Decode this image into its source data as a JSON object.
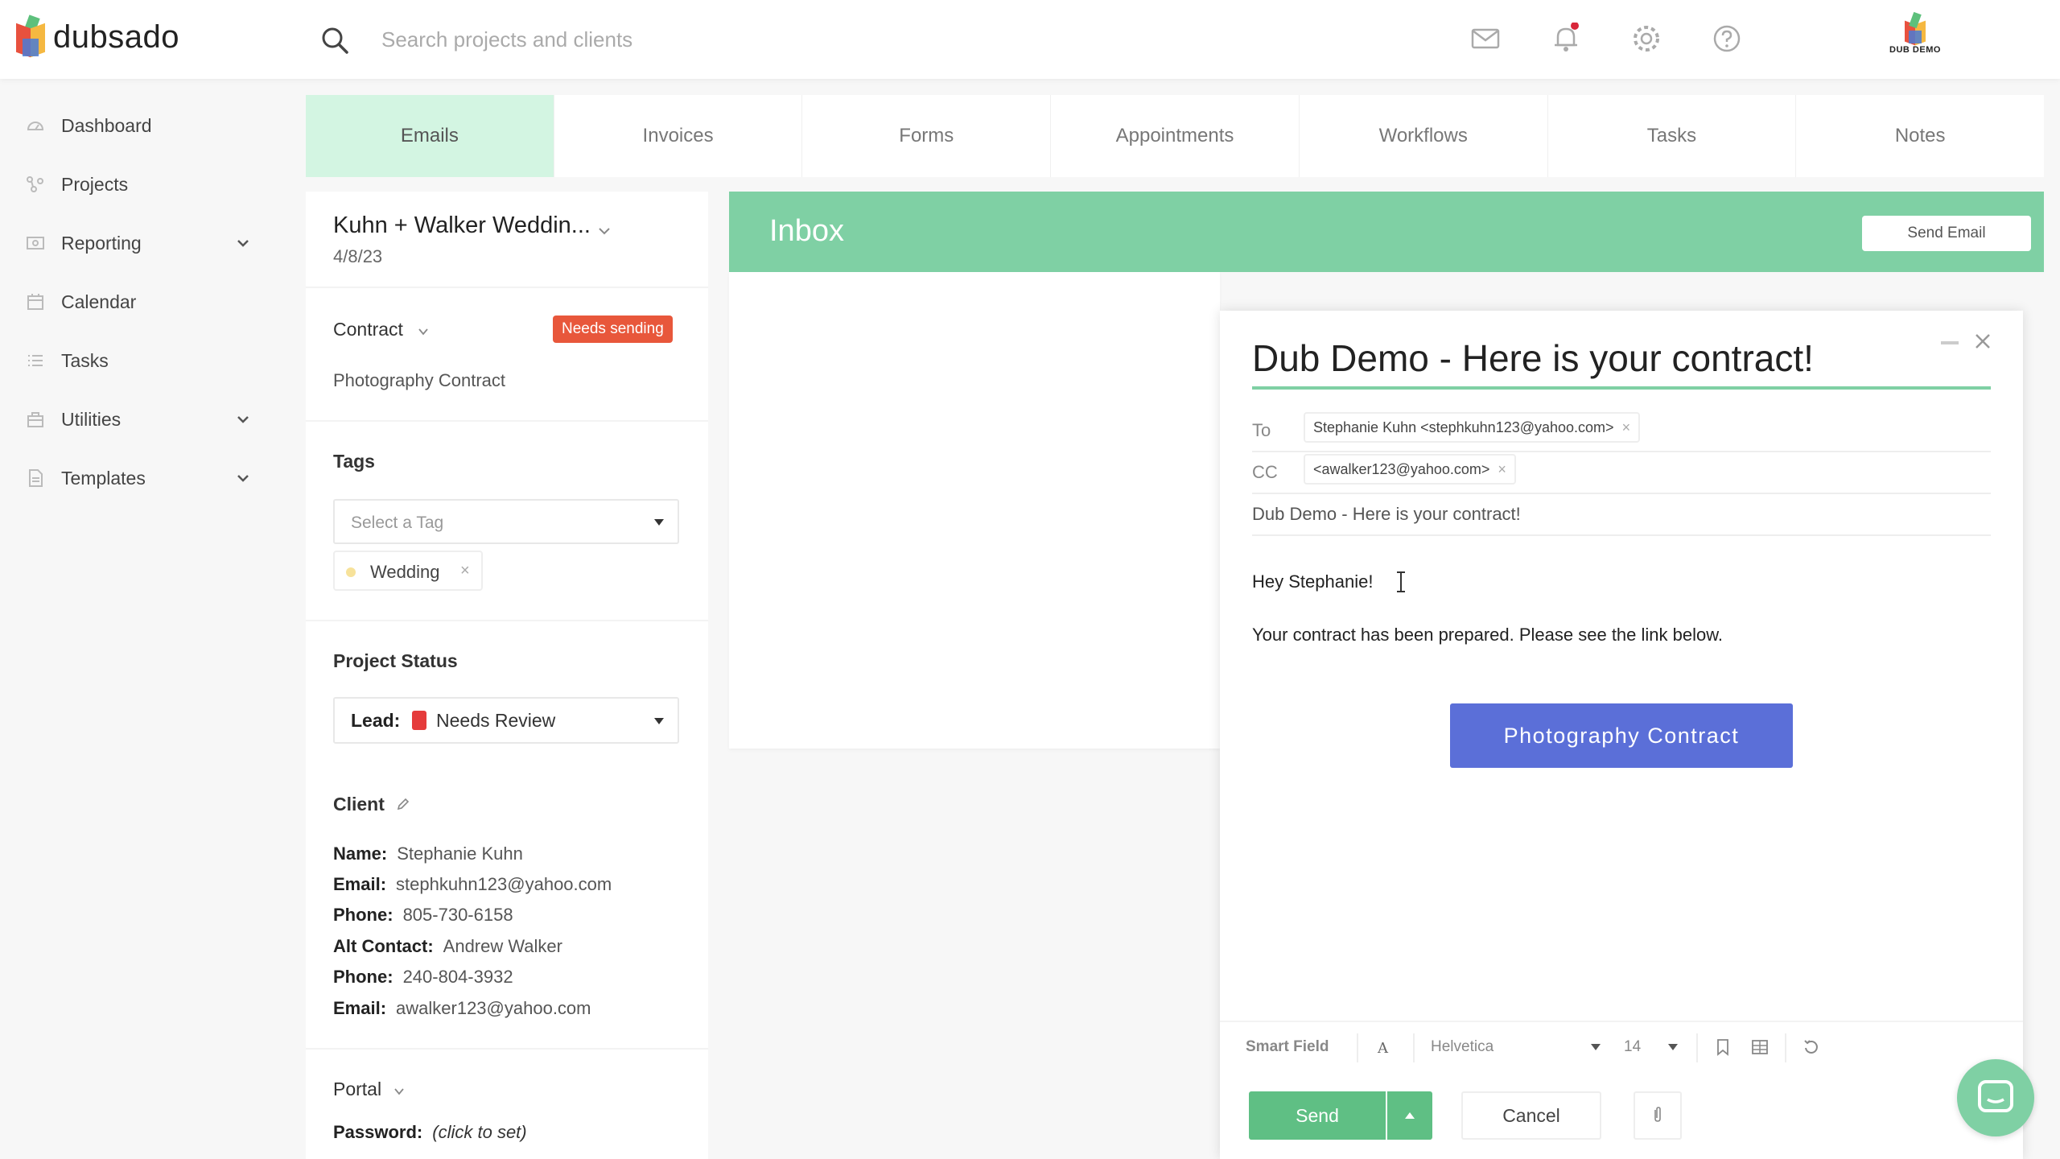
{
  "app": {
    "brand": "dubsado",
    "avatar_label": "DUB DEMO"
  },
  "search": {
    "placeholder": "Search projects and clients"
  },
  "sidebar": {
    "items": [
      {
        "label": "Dashboard",
        "icon": "dashboard-icon"
      },
      {
        "label": "Projects",
        "icon": "projects-icon"
      },
      {
        "label": "Reporting",
        "icon": "reporting-icon",
        "expandable": true
      },
      {
        "label": "Calendar",
        "icon": "calendar-icon"
      },
      {
        "label": "Tasks",
        "icon": "tasks-icon"
      },
      {
        "label": "Utilities",
        "icon": "utilities-icon",
        "expandable": true
      },
      {
        "label": "Templates",
        "icon": "templates-icon",
        "expandable": true
      }
    ]
  },
  "tabs": [
    "Emails",
    "Invoices",
    "Forms",
    "Appointments",
    "Workflows",
    "Tasks",
    "Notes"
  ],
  "active_tab": "Emails",
  "project": {
    "title": "Kuhn + Walker Weddin...",
    "date": "4/8/23",
    "contract_label": "Contract",
    "contract_badge": "Needs sending",
    "contract_name": "Photography Contract",
    "tags_label": "Tags",
    "tags_placeholder": "Select a Tag",
    "tag": "Wedding",
    "status_label": "Project Status",
    "status_prefix": "Lead:",
    "status_value": "Needs Review",
    "client_label": "Client",
    "client": [
      {
        "k": "Name:",
        "v": "Stephanie Kuhn"
      },
      {
        "k": "Email:",
        "v": "stephkuhn123@yahoo.com"
      },
      {
        "k": "Phone:",
        "v": "805-730-6158"
      },
      {
        "k": "Alt Contact:",
        "v": "Andrew Walker"
      },
      {
        "k": "Phone:",
        "v": "240-804-3932"
      },
      {
        "k": "Email:",
        "v": "awalker123@yahoo.com"
      }
    ],
    "portal_label": "Portal",
    "password_key": "Password:",
    "password_val": "(click to set)"
  },
  "inbox": {
    "title": "Inbox",
    "send_email": "Send Email"
  },
  "compose": {
    "title": "Dub Demo - Here is your contract!",
    "to_label": "To",
    "to": "Stephanie Kuhn <stephkuhn123@yahoo.com>",
    "cc_label": "CC",
    "cc": "<awalker123@yahoo.com>",
    "subject": "Dub Demo - Here is your contract!",
    "greeting": "Hey Stephanie!",
    "body": "Your contract has been prepared. Please see the link below.",
    "button": "Photography Contract",
    "smart_field": "Smart Field",
    "font": "Helvetica",
    "font_size": "14",
    "send": "Send",
    "cancel": "Cancel"
  },
  "colors": {
    "accent": "#7fd0a4",
    "tab_active": "#d3f5e2",
    "badge": "#e8573b",
    "contract_button": "#5b6fd8",
    "send": "#5fbf84"
  }
}
